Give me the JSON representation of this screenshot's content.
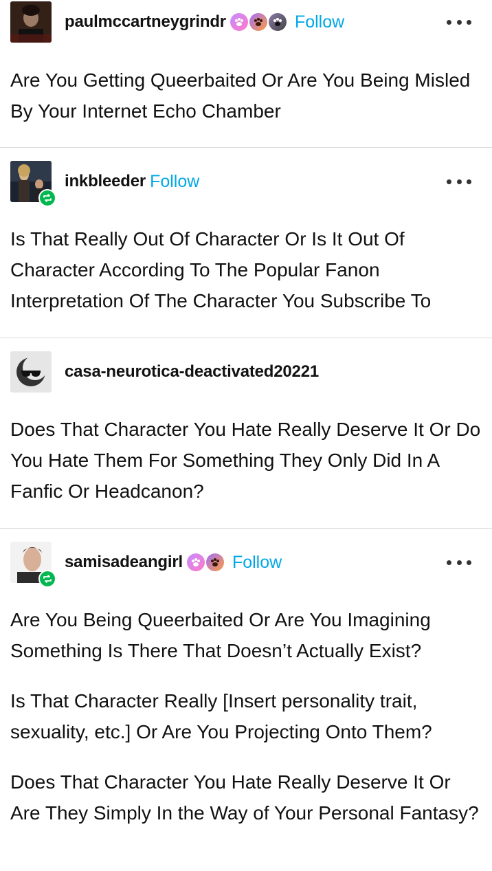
{
  "posts": [
    {
      "username": "paulmccartneygrindr",
      "follow_label": "Follow",
      "has_reblog_badge": false,
      "badges": [
        "paw-badge-pink",
        "paw-badge-orange",
        "paw-badge-black"
      ],
      "paragraphs": [
        "Are You Getting Queerbaited Or Are You Being Misled By Your Internet Echo Chamber"
      ]
    },
    {
      "username": "inkbleeder",
      "follow_label": "Follow",
      "has_reblog_badge": true,
      "badges": [],
      "paragraphs": [
        "Is That Really Out Of Character Or Is It Out Of Character According To The Popular Fanon Interpretation Of The Character You Subscribe To"
      ]
    },
    {
      "username": "casa-neurotica-deactivated20221",
      "follow_label": "",
      "has_reblog_badge": false,
      "badges": [],
      "paragraphs": [
        "Does That Character You Hate Really Deserve It Or Do You Hate Them For Something They Only Did In A Fanfic Or Headcanon?"
      ]
    },
    {
      "username": "samisadeangirl",
      "follow_label": "Follow",
      "has_reblog_badge": true,
      "badges": [
        "paw-badge-pink",
        "paw-badge-orange"
      ],
      "paragraphs": [
        "Are You Being Queerbaited Or Are You Imagining Something Is There That Doesn’t Actually Exist?",
        "Is That Character Really [Insert personality trait, sexuality, etc.] Or Are You Projecting Onto Them?",
        "Does That Character You Hate Really Deserve It Or Are They Simply In the Way of Your Personal Fantasy?"
      ]
    }
  ],
  "colors": {
    "follow": "#00a8e6",
    "reblog_badge": "#00b84f",
    "divider": "#dcdcdc"
  }
}
